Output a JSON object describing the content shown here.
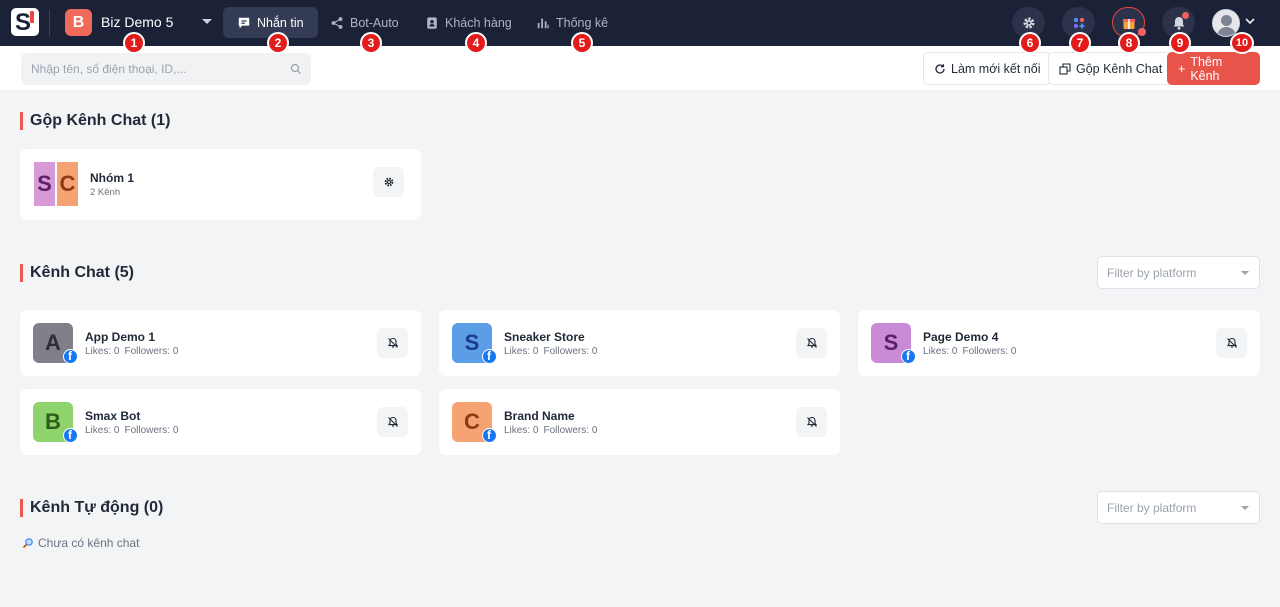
{
  "app": {
    "logo_letter": "S",
    "workspace": {
      "avatar_letter": "B",
      "name": "Biz Demo 5"
    }
  },
  "nav": {
    "tabs": [
      {
        "label": "Nhắn tin",
        "icon": "chat-bubble-icon",
        "active": true
      },
      {
        "label": "Bot-Auto",
        "icon": "share-nodes-icon",
        "active": false
      },
      {
        "label": "Khách hàng",
        "icon": "contact-card-icon",
        "active": false
      },
      {
        "label": "Thống kê",
        "icon": "bar-chart-icon",
        "active": false
      }
    ]
  },
  "markers": [
    "1",
    "2",
    "3",
    "4",
    "5",
    "6",
    "7",
    "8",
    "9",
    "10"
  ],
  "toolbar": {
    "search_placeholder": "Nhập tên, số điện thoại, ID,...",
    "refresh_label": "Làm mới kết nối",
    "merge_label": "Gộp Kênh Chat",
    "add_label": "Thêm Kênh",
    "add_prefix": "+"
  },
  "groups_section": {
    "title": "Gộp Kênh Chat (1)",
    "items": [
      {
        "name": "Nhóm 1",
        "subtitle": "2 Kênh",
        "letters": [
          "S",
          "C"
        ]
      }
    ]
  },
  "channels_section": {
    "title": "Kênh Chat (5)",
    "filter_placeholder": "Filter by platform",
    "items": [
      {
        "letter": "A",
        "name": "App Demo 1",
        "likes": "Likes: 0",
        "followers": "Followers: 0",
        "bg": "#7f8088",
        "fg": "#2e2f35"
      },
      {
        "letter": "S",
        "name": "Sneaker Store",
        "likes": "Likes: 0",
        "followers": "Followers: 0",
        "bg": "#5b9de6",
        "fg": "#1e3a8a"
      },
      {
        "letter": "S",
        "name": "Page Demo 4",
        "likes": "Likes: 0",
        "followers": "Followers: 0",
        "bg": "#c98ad6",
        "fg": "#5b2166"
      },
      {
        "letter": "B",
        "name": "Smax Bot",
        "likes": "Likes: 0",
        "followers": "Followers: 0",
        "bg": "#8ed36b",
        "fg": "#2f5e1a"
      },
      {
        "letter": "C",
        "name": "Brand Name",
        "likes": "Likes: 0",
        "followers": "Followers: 0",
        "bg": "#f6a272",
        "fg": "#8a3c14"
      }
    ]
  },
  "auto_section": {
    "title": "Kênh Tự động (0)",
    "filter_placeholder": "Filter by platform",
    "empty_text": "Chưa có kênh chat"
  },
  "colors": {
    "nav_bg": "#1b2137",
    "accent": "#e8534a",
    "facebook": "#1877f2",
    "group_left_bg": "#d89ad7",
    "group_left_fg": "#5b2166",
    "group_right_bg": "#f6a272",
    "group_right_fg": "#8a3c14"
  }
}
